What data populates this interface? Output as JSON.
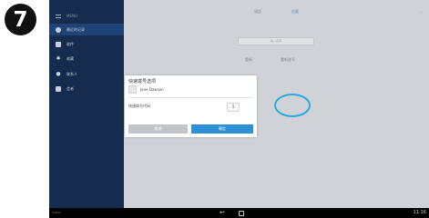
{
  "step": {
    "number": "7"
  },
  "sidebar": {
    "items": [
      {
        "label": "MENU",
        "icon": "menu-icon"
      },
      {
        "label": "最近的记录",
        "icon": "recent-icon"
      },
      {
        "label": "收件",
        "icon": "favorites-icon"
      },
      {
        "label": "收藏",
        "icon": "star-icon"
      },
      {
        "label": "联系人",
        "icon": "person-icon"
      },
      {
        "label": "会者",
        "icon": "meeting-icon"
      }
    ]
  },
  "header": {
    "tabs": [
      "键盘",
      "收藏",
      "..."
    ]
  },
  "main": {
    "search_placeholder": "输入名称",
    "labels": [
      "重新",
      "重新拨号"
    ]
  },
  "dialog": {
    "title": "快速拨号选项",
    "contact_name": "Jane Dawson",
    "field_label": "快速拨号代码",
    "field_value": "1",
    "cancel_label": "取消",
    "ok_label": "确定"
  },
  "statusbar": {
    "left_text": "CISCO",
    "time": "11:16"
  },
  "colors": {
    "sidebar": "#152c4e",
    "accent": "#2f8fd6",
    "highlight": "#29a9e0"
  }
}
